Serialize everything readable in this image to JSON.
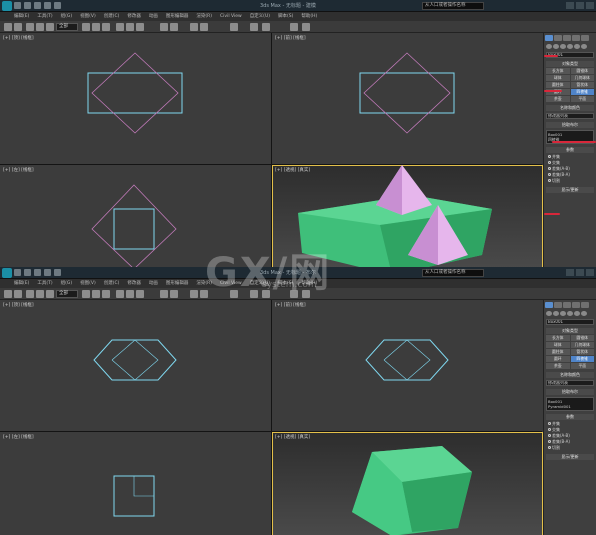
{
  "screenshots": [
    {
      "title": "3ds Max - 无标题 - 建模",
      "path_field": "从人口或者操作名称",
      "menus": [
        "编辑(E)",
        "工具(T)",
        "组(G)",
        "视图(V)",
        "创建(C)",
        "修改器",
        "动画",
        "图形编辑器",
        "渲染(R)",
        "Civil View",
        "自定义(U)",
        "脚本(S)",
        "帮助(H)"
      ],
      "selection_filter": "全部",
      "viewports": [
        {
          "label": "[+] [顶] [线框]"
        },
        {
          "label": "[+] [前] [线框]"
        },
        {
          "label": "[+] [左] [线框]"
        },
        {
          "label": "[+] [透视] [真实]"
        }
      ],
      "command_panel": {
        "object_name": "Box001",
        "section_type": "对象类型",
        "buttons": [
          "长方体",
          "圆锥体",
          "球体",
          "几何球体",
          "圆柱体",
          "管状体",
          "圆环",
          "四棱锥",
          "茶壶",
          "平面"
        ],
        "highlighted": "四棱锥",
        "name_color": "名称和颜色",
        "modifier_list": "修改器列表",
        "stack": [
          "Box001",
          "四棱锥"
        ],
        "selection_head": "参数",
        "radio": [
          "并集",
          "交集",
          "差集(A-B)",
          "差集(B-A)",
          "切割"
        ],
        "panel_heads": [
          "拾取布尔",
          "参数",
          "显示/更新"
        ]
      }
    },
    {
      "title": "3ds Max - 无标题 - 布尔",
      "path_field": "从人口或者操作名称",
      "menus": [
        "编辑(E)",
        "工具(T)",
        "组(G)",
        "视图(V)",
        "创建(C)",
        "修改器",
        "动画",
        "图形编辑器",
        "渲染(R)",
        "Civil View",
        "自定义(U)",
        "脚本(S)",
        "帮助(H)"
      ],
      "selection_filter": "全部",
      "viewports": [
        {
          "label": "[+] [顶] [线框]"
        },
        {
          "label": "[+] [前] [线框]"
        },
        {
          "label": "[+] [左] [线框]"
        },
        {
          "label": "[+] [透视] [真实]"
        }
      ],
      "command_panel": {
        "object_name": "Box001",
        "section_type": "对象类型",
        "buttons": [
          "长方体",
          "圆锥体",
          "球体",
          "几何球体",
          "圆柱体",
          "管状体",
          "圆环",
          "四棱锥",
          "茶壶",
          "平面"
        ],
        "highlighted": "四棱锥",
        "name_color": "名称和颜色",
        "modifier_list": "修改器列表",
        "stack": [
          "Box001",
          "Pyramid001"
        ],
        "selection_head": "参数",
        "radio": [
          "并集",
          "交集",
          "差集(A-B)",
          "差集(B-A)",
          "切割"
        ],
        "panel_heads": [
          "拾取布尔",
          "参数",
          "显示/更新"
        ]
      }
    }
  ],
  "watermark": {
    "text": "GX/网",
    "sub": "system.com"
  },
  "colors": {
    "accent": "#4f84c9",
    "annotation": "#d8273a",
    "box": "#3fbf7a",
    "pyramid": "#d9a0e0",
    "wire_cyan": "#7fd8f0",
    "wire_pink": "#c07ab8"
  }
}
